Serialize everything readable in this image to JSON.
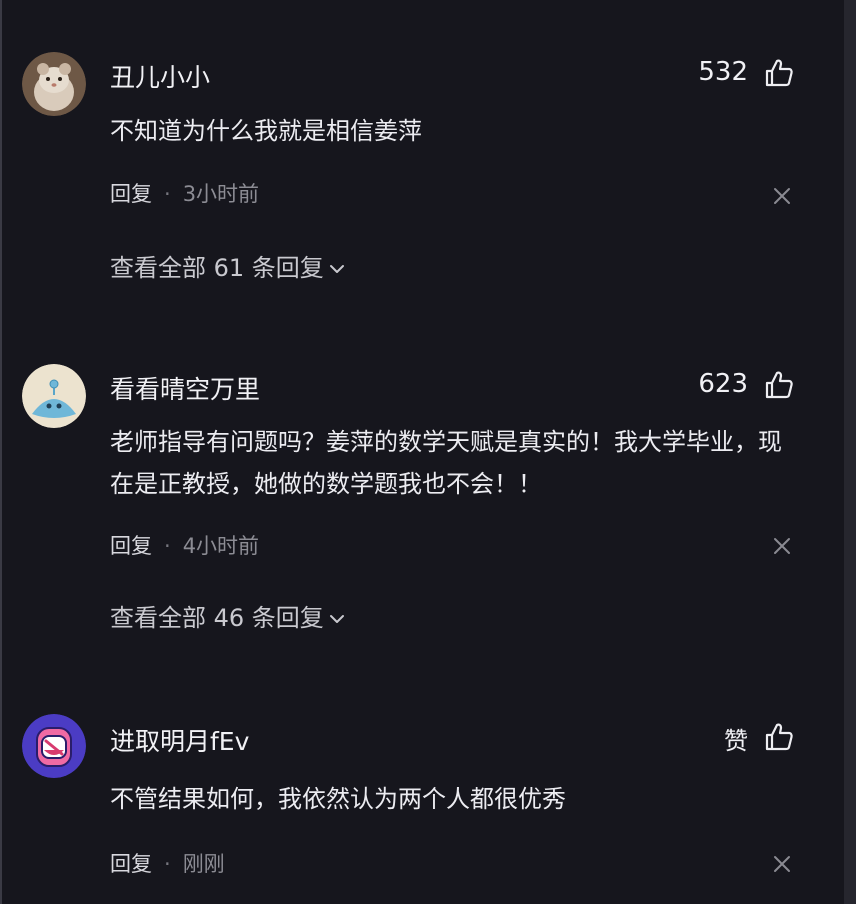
{
  "reply_label": "回复",
  "separator": "·",
  "comments": [
    {
      "username": "丑儿小小",
      "likes": "532",
      "text": "不知道为什么我就是相信姜萍",
      "time": "3小时前",
      "view_replies_label": "查看全部 61 条回复"
    },
    {
      "username": "看看晴空万里",
      "likes": "623",
      "text": "老师指导有问题吗？姜萍的数学天赋是真实的！我大学毕业，现在是正教授，她做的数学题我也不会！！",
      "time": "4小时前",
      "view_replies_label": "查看全部 46 条回复"
    },
    {
      "username": "进取明月fEv",
      "likes": "赞",
      "text": "不管结果如何，我依然认为两个人都很优秀",
      "time": "刚刚"
    }
  ],
  "colors": {
    "background": "#16161d",
    "text": "#ececf1",
    "muted": "#8c8c94"
  }
}
